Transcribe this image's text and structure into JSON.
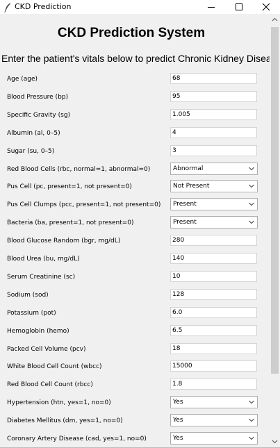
{
  "window": {
    "title": "CKD Prediction"
  },
  "header": {
    "title": "CKD Prediction System",
    "subtitle": "Enter the patient's vitals below to predict Chronic Kidney Disease"
  },
  "fields": [
    {
      "label": "Age (age)",
      "type": "input",
      "value": "68"
    },
    {
      "label": "Blood Pressure (bp)",
      "type": "input",
      "value": "95"
    },
    {
      "label": "Specific Gravity (sg)",
      "type": "input",
      "value": "1.005"
    },
    {
      "label": "Albumin (al, 0–5)",
      "type": "input",
      "value": "4"
    },
    {
      "label": "Sugar (su, 0–5)",
      "type": "input",
      "value": "3"
    },
    {
      "label": "Red Blood Cells (rbc, normal=1, abnormal=0)",
      "type": "select",
      "value": "Abnormal"
    },
    {
      "label": "Pus Cell (pc, present=1, not present=0)",
      "type": "select",
      "value": "Not Present"
    },
    {
      "label": "Pus Cell Clumps (pcc, present=1, not present=0)",
      "type": "select",
      "value": "Present"
    },
    {
      "label": "Bacteria (ba, present=1, not present=0)",
      "type": "select",
      "value": "Present"
    },
    {
      "label": "Blood Glucose Random (bgr, mg/dL)",
      "type": "input",
      "value": "280"
    },
    {
      "label": "Blood Urea (bu, mg/dL)",
      "type": "input",
      "value": "140"
    },
    {
      "label": "Serum Creatinine (sc)",
      "type": "input",
      "value": "10"
    },
    {
      "label": "Sodium (sod)",
      "type": "input",
      "value": "128"
    },
    {
      "label": "Potassium (pot)",
      "type": "input",
      "value": "6.0"
    },
    {
      "label": "Hemoglobin (hemo)",
      "type": "input",
      "value": "6.5"
    },
    {
      "label": "Packed Cell Volume (pcv)",
      "type": "input",
      "value": "18"
    },
    {
      "label": "White Blood Cell Count (wbcc)",
      "type": "input",
      "value": "15000"
    },
    {
      "label": "Red Blood Cell Count (rbcc)",
      "type": "input",
      "value": "1.8"
    },
    {
      "label": "Hypertension (htn, yes=1, no=0)",
      "type": "select",
      "value": "Yes"
    },
    {
      "label": "Diabetes Mellitus (dm, yes=1, no=0)",
      "type": "select",
      "value": "Yes"
    },
    {
      "label": "Coronary Artery Disease (cad, yes=1, no=0)",
      "type": "select",
      "value": "Yes"
    }
  ],
  "icons": {
    "app": "feather-icon",
    "minimize": "minimize-icon",
    "maximize": "maximize-icon",
    "close": "close-icon",
    "dropdown": "chevron-down-icon",
    "scroll_up": "scroll-up-icon",
    "scroll_down": "scroll-down-icon"
  }
}
